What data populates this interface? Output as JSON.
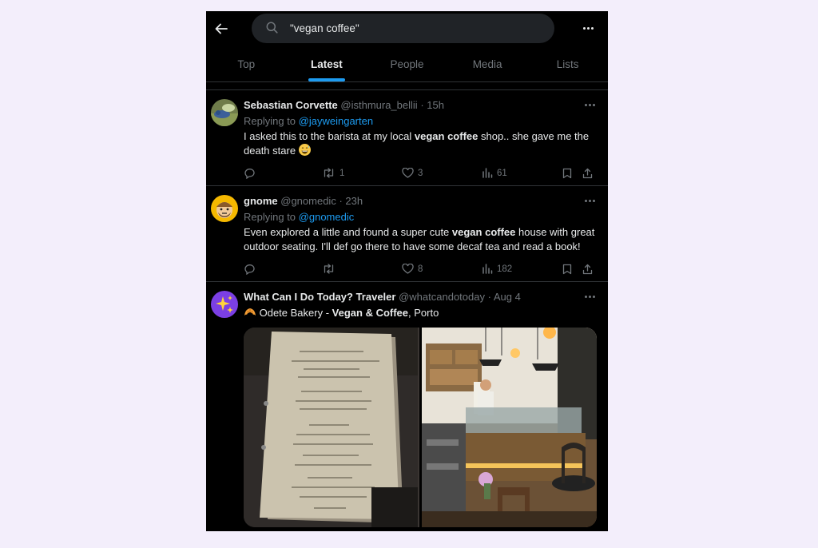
{
  "search": {
    "query": "\"vegan coffee\""
  },
  "tabs": [
    {
      "label": "Top"
    },
    {
      "label": "Latest"
    },
    {
      "label": "People"
    },
    {
      "label": "Media"
    },
    {
      "label": "Lists"
    }
  ],
  "active_tab": "Latest",
  "colors": {
    "accent": "#1d9bf0",
    "background": "#000000",
    "text": "#e7e9ea",
    "muted": "#71767b"
  },
  "tweets": [
    {
      "name": "Sebastian Corvette",
      "handle": "@isthmura_bellii",
      "time": "· 15h",
      "reply_prefix": "Replying to",
      "reply_to": "@jayweingarten",
      "text_1": "I asked this to the barista at my local ",
      "text_bold": "vegan coffee",
      "text_2": " shop.. she gave me the death stare",
      "emoji": "grinning-sweat-emoji",
      "retweets": "1",
      "likes": "3",
      "views": "61"
    },
    {
      "name": "gnome",
      "handle": "@gnomedic",
      "time": "· 23h",
      "reply_prefix": "Replying to",
      "reply_to": "@gnomedic",
      "text_1": "Even explored a little and found a super cute ",
      "text_bold": "vegan coffee",
      "text_2": " house with great outdoor seating. I'll def go there to have some decaf tea and read a book!",
      "retweets": "",
      "likes": "8",
      "views": "182"
    },
    {
      "name": "What Can I Do Today? Traveler",
      "handle": "@whatcandotoday",
      "time": "· Aug 4",
      "emoji": "croissant-emoji",
      "text_1": " Odete Bakery - ",
      "text_bold": "Vegan & Coffee",
      "text_2": ", Porto",
      "media": [
        "menu-photo",
        "cafe-interior-photo"
      ]
    }
  ]
}
